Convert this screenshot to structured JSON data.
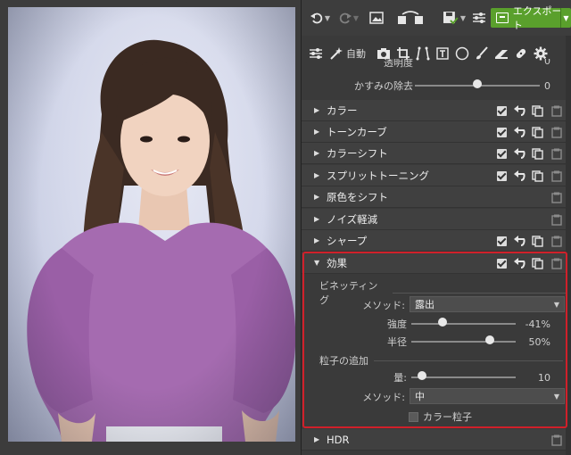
{
  "toolbar": {
    "export_label": "エクスポート",
    "auto_label": "自動"
  },
  "top_sliders": [
    {
      "label": "透明度",
      "value": "0",
      "position": 1.0
    },
    {
      "label": "かすみの除去",
      "value": "0",
      "position": 0.5
    }
  ],
  "sections": [
    {
      "title": "カラー",
      "enabled": true
    },
    {
      "title": "トーンカーブ",
      "enabled": true
    },
    {
      "title": "カラーシフト",
      "enabled": true
    },
    {
      "title": "スプリットトーニング",
      "enabled": true
    },
    {
      "title": "原色をシフト",
      "enabled": false
    },
    {
      "title": "ノイズ軽減",
      "enabled": false
    },
    {
      "title": "シャープ",
      "enabled": true
    }
  ],
  "effects": {
    "title": "効果",
    "vignetting": {
      "heading": "ビネッティング",
      "method_label": "メソッド:",
      "method_value": "露出",
      "strength_label": "強度",
      "strength_value": "-41%",
      "strength_pos": 0.295,
      "radius_label": "半径",
      "radius_value": "50%",
      "radius_pos": 0.75
    },
    "grain": {
      "heading": "粒子の追加",
      "amount_label": "量:",
      "amount_value": "10",
      "amount_pos": 0.1,
      "method_label": "メソッド:",
      "method_value": "中",
      "color_grain_label": "カラー粒子",
      "color_grain_checked": false
    }
  },
  "hdr": {
    "title": "HDR"
  },
  "colors": {
    "accent_green": "#5aa02c",
    "highlight_red": "#d0202a"
  }
}
